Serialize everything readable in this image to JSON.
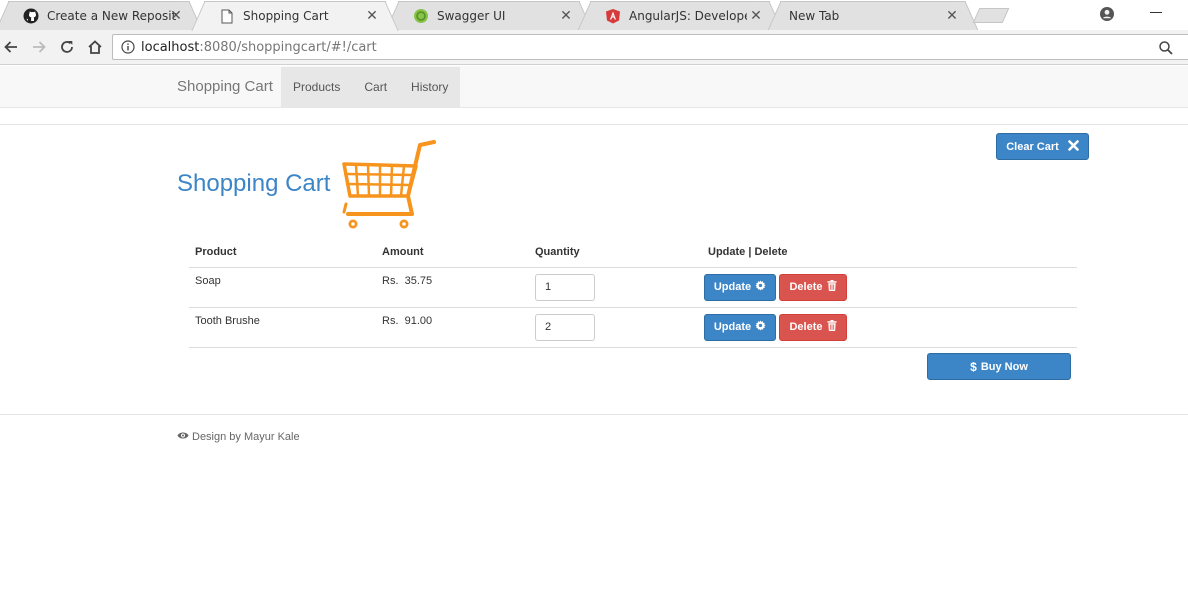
{
  "browser": {
    "tabs": [
      {
        "title": "Create a New Repository",
        "icon": "github-icon"
      },
      {
        "title": "Shopping Cart",
        "icon": "page-icon",
        "active": true
      },
      {
        "title": "Swagger UI",
        "icon": "swagger-icon"
      },
      {
        "title": "AngularJS: Developer Gu",
        "icon": "angular-icon"
      },
      {
        "title": "New Tab",
        "icon": ""
      }
    ],
    "url_host": "localhost",
    "url_rest": ":8080/shoppingcart/#!/cart"
  },
  "navbar": {
    "brand": "Shopping Cart",
    "items": [
      "Products",
      "Cart",
      "History"
    ]
  },
  "page": {
    "title": "Shopping Cart",
    "clear_cart_label": "Clear Cart",
    "buy_now_label": "Buy Now"
  },
  "table": {
    "headers": [
      "Product",
      "Amount",
      "Quantity",
      "Update | Delete"
    ],
    "rows": [
      {
        "product": "Soap",
        "amount": "Rs.  35.75",
        "quantity": "1"
      },
      {
        "product": "Tooth Brushe",
        "amount": "Rs.  91.00",
        "quantity": "2"
      }
    ],
    "update_label": "Update",
    "delete_label": "Delete"
  },
  "footer": {
    "text": "Design by Mayur Kale"
  },
  "colors": {
    "primary": "#3c85c6",
    "danger": "#d9534f",
    "cart_logo": "#f7941d"
  }
}
